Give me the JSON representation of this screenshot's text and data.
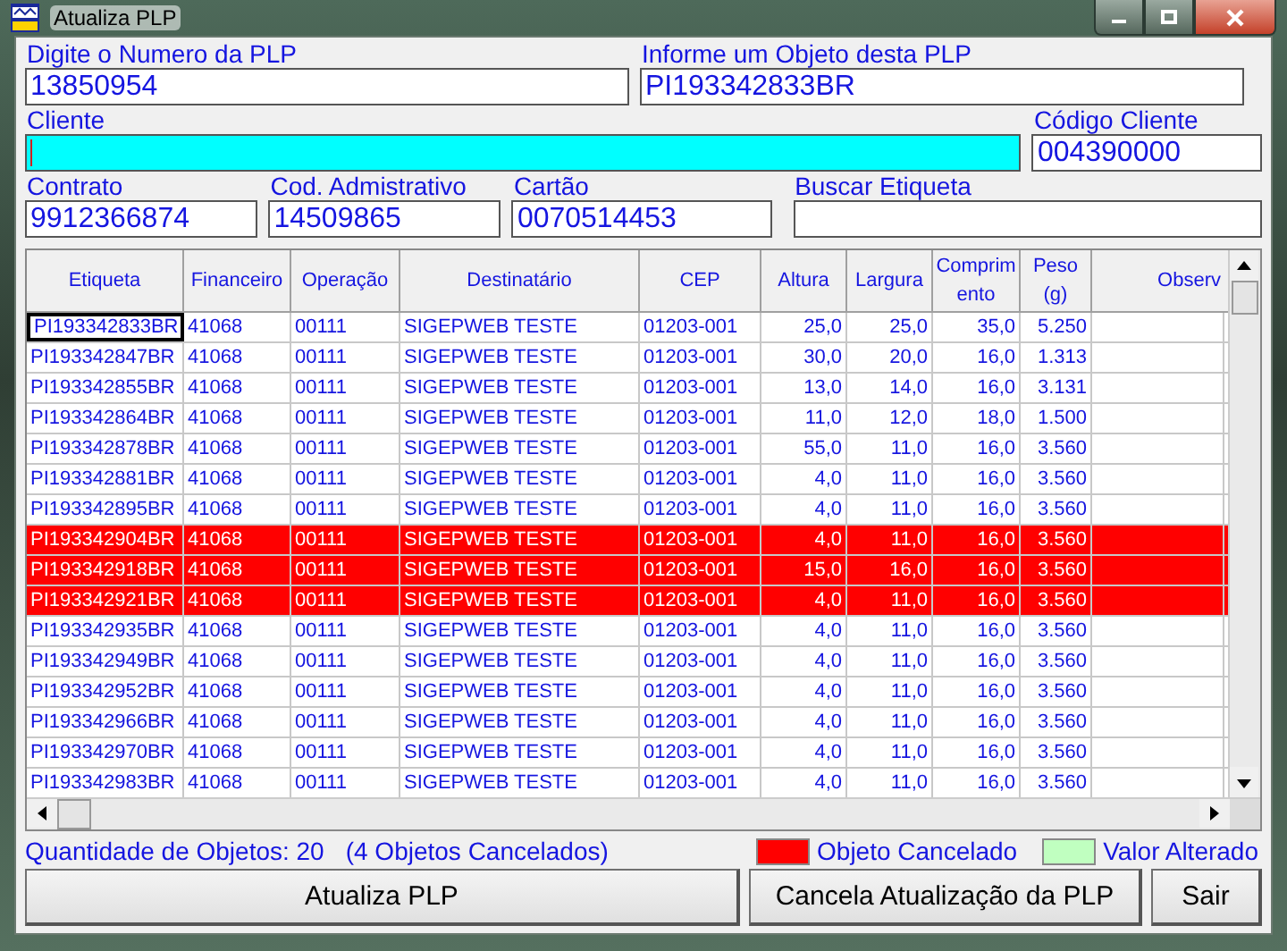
{
  "window": {
    "title": "Atualiza PLP"
  },
  "fields": [
    {
      "label": "Digite o Numero da PLP",
      "value": "13850954",
      "highlighted": false
    },
    {
      "label": "Informe um Objeto desta PLP",
      "value": "PI193342833BR",
      "highlighted": false
    },
    {
      "label": "Cliente",
      "highlighted": true
    },
    {
      "label": "Código Cliente",
      "value": "004390000",
      "highlighted": false
    },
    {
      "label": "Contrato",
      "value": "9912366874",
      "highlighted": false
    },
    {
      "label": "Cod. Admistrativo",
      "value": "14509865",
      "highlighted": false
    },
    {
      "label": "Cartão",
      "value": "0070514453",
      "highlighted": false
    },
    {
      "label": "Buscar Etiqueta",
      "highlighted": false
    }
  ],
  "table": {
    "columns": [
      "Etiqueta",
      "Financeiro",
      "Operação",
      "Destinatário",
      "CEP",
      "Altura",
      "Largura",
      "Comprim ento",
      "Peso (g)",
      "Observ"
    ],
    "rows": [
      {
        "cells": [
          "PI193342833BR",
          "41068",
          "00111",
          "SIGEPWEB TESTE",
          "01203-001",
          "25,0",
          "25,0",
          "35,0",
          "5.250",
          ""
        ],
        "cancelled": false,
        "focused": true
      },
      {
        "cells": [
          "PI193342847BR",
          "41068",
          "00111",
          "SIGEPWEB TESTE",
          "01203-001",
          "30,0",
          "20,0",
          "16,0",
          "1.313",
          ""
        ],
        "cancelled": false,
        "focused": false
      },
      {
        "cells": [
          "PI193342855BR",
          "41068",
          "00111",
          "SIGEPWEB TESTE",
          "01203-001",
          "13,0",
          "14,0",
          "16,0",
          "3.131",
          ""
        ],
        "cancelled": false,
        "focused": false
      },
      {
        "cells": [
          "PI193342864BR",
          "41068",
          "00111",
          "SIGEPWEB TESTE",
          "01203-001",
          "11,0",
          "12,0",
          "18,0",
          "1.500",
          ""
        ],
        "cancelled": false,
        "focused": false
      },
      {
        "cells": [
          "PI193342878BR",
          "41068",
          "00111",
          "SIGEPWEB TESTE",
          "01203-001",
          "55,0",
          "11,0",
          "16,0",
          "3.560",
          ""
        ],
        "cancelled": false,
        "focused": false
      },
      {
        "cells": [
          "PI193342881BR",
          "41068",
          "00111",
          "SIGEPWEB TESTE",
          "01203-001",
          "4,0",
          "11,0",
          "16,0",
          "3.560",
          ""
        ],
        "cancelled": false,
        "focused": false
      },
      {
        "cells": [
          "PI193342895BR",
          "41068",
          "00111",
          "SIGEPWEB TESTE",
          "01203-001",
          "4,0",
          "11,0",
          "16,0",
          "3.560",
          ""
        ],
        "cancelled": false,
        "focused": false
      },
      {
        "cells": [
          "PI193342904BR",
          "41068",
          "00111",
          "SIGEPWEB TESTE",
          "01203-001",
          "4,0",
          "11,0",
          "16,0",
          "3.560",
          ""
        ],
        "cancelled": true,
        "focused": false
      },
      {
        "cells": [
          "PI193342918BR",
          "41068",
          "00111",
          "SIGEPWEB TESTE",
          "01203-001",
          "15,0",
          "16,0",
          "16,0",
          "3.560",
          ""
        ],
        "cancelled": true,
        "focused": false
      },
      {
        "cells": [
          "PI193342921BR",
          "41068",
          "00111",
          "SIGEPWEB TESTE",
          "01203-001",
          "4,0",
          "11,0",
          "16,0",
          "3.560",
          ""
        ],
        "cancelled": true,
        "focused": false
      },
      {
        "cells": [
          "PI193342935BR",
          "41068",
          "00111",
          "SIGEPWEB TESTE",
          "01203-001",
          "4,0",
          "11,0",
          "16,0",
          "3.560",
          ""
        ],
        "cancelled": false,
        "focused": false
      },
      {
        "cells": [
          "PI193342949BR",
          "41068",
          "00111",
          "SIGEPWEB TESTE",
          "01203-001",
          "4,0",
          "11,0",
          "16,0",
          "3.560",
          ""
        ],
        "cancelled": false,
        "focused": false
      },
      {
        "cells": [
          "PI193342952BR",
          "41068",
          "00111",
          "SIGEPWEB TESTE",
          "01203-001",
          "4,0",
          "11,0",
          "16,0",
          "3.560",
          ""
        ],
        "cancelled": false,
        "focused": false
      },
      {
        "cells": [
          "PI193342966BR",
          "41068",
          "00111",
          "SIGEPWEB TESTE",
          "01203-001",
          "4,0",
          "11,0",
          "16,0",
          "3.560",
          ""
        ],
        "cancelled": false,
        "focused": false
      },
      {
        "cells": [
          "PI193342970BR",
          "41068",
          "00111",
          "SIGEPWEB TESTE",
          "01203-001",
          "4,0",
          "11,0",
          "16,0",
          "3.560",
          ""
        ],
        "cancelled": false,
        "focused": false
      },
      {
        "cells": [
          "PI193342983BR",
          "41068",
          "00111",
          "SIGEPWEB TESTE",
          "01203-001",
          "4,0",
          "11,0",
          "16,0",
          "3.560",
          ""
        ],
        "cancelled": false,
        "focused": false
      }
    ]
  },
  "status": {
    "count": "Quantidade de Objetos: 20",
    "cancelled": "(4 Objetos Cancelados)"
  },
  "legend": [
    {
      "label": "Objeto Cancelado",
      "color": "#ff0000"
    },
    {
      "label": "Valor Alterado",
      "color": "#c0ffc0"
    }
  ],
  "buttons": [
    "Atualiza PLP",
    "Cancela Atualização da PLP",
    "Sair"
  ]
}
